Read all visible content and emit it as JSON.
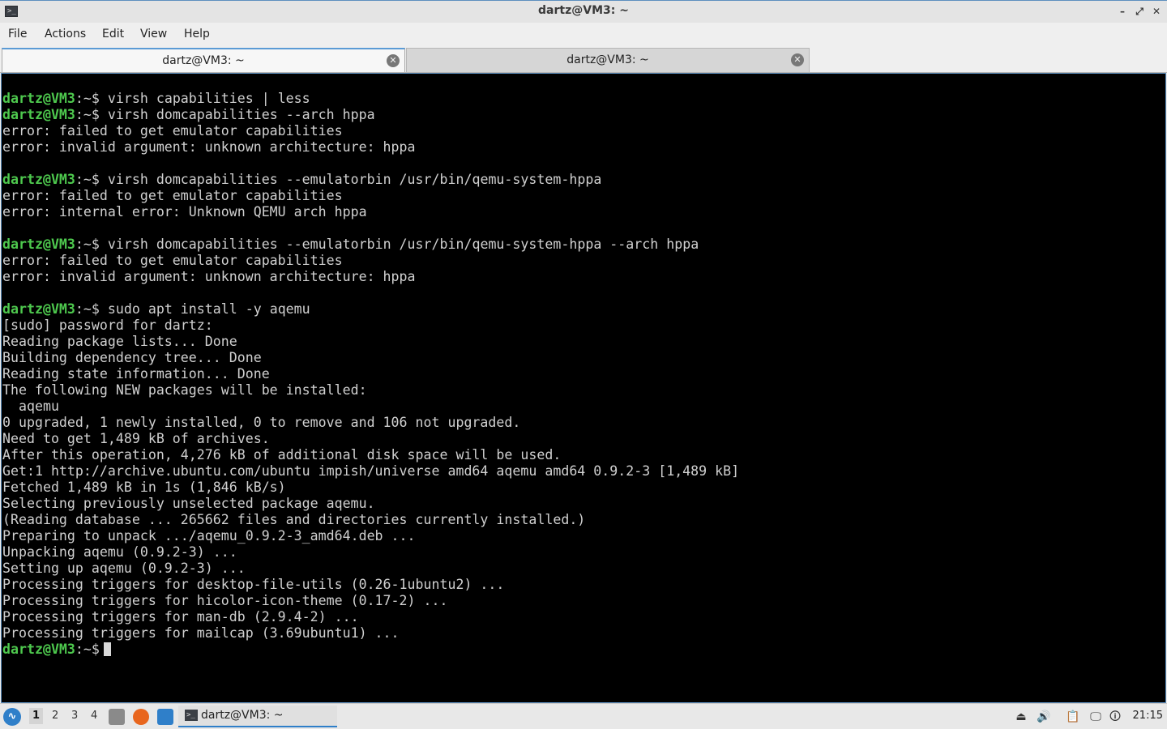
{
  "window": {
    "title": "dartz@VM3: ~",
    "app_icon_glyph": ">_",
    "controls": {
      "minimize": "–",
      "maximize": "⤢",
      "close": "✕"
    }
  },
  "menubar": {
    "items": [
      "File",
      "Actions",
      "Edit",
      "View",
      "Help"
    ]
  },
  "tabs": [
    {
      "label": "dartz@VM3: ~",
      "active": true,
      "close": "✕"
    },
    {
      "label": "dartz@VM3: ~",
      "active": false,
      "close": "✕"
    }
  ],
  "terminal": {
    "prompt_user": "dartz@VM3",
    "prompt_path": ":~$",
    "lines": [
      {
        "prompt": true,
        "text": " virsh capabilities | less"
      },
      {
        "prompt": true,
        "text": " virsh domcapabilities --arch hppa"
      },
      {
        "prompt": false,
        "text": "error: failed to get emulator capabilities"
      },
      {
        "prompt": false,
        "text": "error: invalid argument: unknown architecture: hppa"
      },
      {
        "prompt": false,
        "text": ""
      },
      {
        "prompt": true,
        "text": " virsh domcapabilities --emulatorbin /usr/bin/qemu-system-hppa"
      },
      {
        "prompt": false,
        "text": "error: failed to get emulator capabilities"
      },
      {
        "prompt": false,
        "text": "error: internal error: Unknown QEMU arch hppa"
      },
      {
        "prompt": false,
        "text": ""
      },
      {
        "prompt": true,
        "text": " virsh domcapabilities --emulatorbin /usr/bin/qemu-system-hppa --arch hppa"
      },
      {
        "prompt": false,
        "text": "error: failed to get emulator capabilities"
      },
      {
        "prompt": false,
        "text": "error: invalid argument: unknown architecture: hppa"
      },
      {
        "prompt": false,
        "text": ""
      },
      {
        "prompt": true,
        "text": " sudo apt install -y aqemu"
      },
      {
        "prompt": false,
        "text": "[sudo] password for dartz:"
      },
      {
        "prompt": false,
        "text": "Reading package lists... Done"
      },
      {
        "prompt": false,
        "text": "Building dependency tree... Done"
      },
      {
        "prompt": false,
        "text": "Reading state information... Done"
      },
      {
        "prompt": false,
        "text": "The following NEW packages will be installed:"
      },
      {
        "prompt": false,
        "text": "  aqemu"
      },
      {
        "prompt": false,
        "text": "0 upgraded, 1 newly installed, 0 to remove and 106 not upgraded."
      },
      {
        "prompt": false,
        "text": "Need to get 1,489 kB of archives."
      },
      {
        "prompt": false,
        "text": "After this operation, 4,276 kB of additional disk space will be used."
      },
      {
        "prompt": false,
        "text": "Get:1 http://archive.ubuntu.com/ubuntu impish/universe amd64 aqemu amd64 0.9.2-3 [1,489 kB]"
      },
      {
        "prompt": false,
        "text": "Fetched 1,489 kB in 1s (1,846 kB/s)"
      },
      {
        "prompt": false,
        "text": "Selecting previously unselected package aqemu."
      },
      {
        "prompt": false,
        "text": "(Reading database ... 265662 files and directories currently installed.)"
      },
      {
        "prompt": false,
        "text": "Preparing to unpack .../aqemu_0.9.2-3_amd64.deb ..."
      },
      {
        "prompt": false,
        "text": "Unpacking aqemu (0.9.2-3) ..."
      },
      {
        "prompt": false,
        "text": "Setting up aqemu (0.9.2-3) ..."
      },
      {
        "prompt": false,
        "text": "Processing triggers for desktop-file-utils (0.26-1ubuntu2) ..."
      },
      {
        "prompt": false,
        "text": "Processing triggers for hicolor-icon-theme (0.17-2) ..."
      },
      {
        "prompt": false,
        "text": "Processing triggers for man-db (2.9.4-2) ..."
      },
      {
        "prompt": false,
        "text": "Processing triggers for mailcap (3.69ubuntu1) ..."
      },
      {
        "prompt": true,
        "text": "",
        "cursor": true
      }
    ]
  },
  "taskbar": {
    "start_icon": "lubuntu-start-icon",
    "desktops": [
      "1",
      "2",
      "3",
      "4"
    ],
    "active_desktop": "1",
    "launchers": [
      {
        "name": "file-manager-icon",
        "color": "#8a8a8a"
      },
      {
        "name": "firefox-icon",
        "color": "#e8661e"
      },
      {
        "name": "show-desktop-icon",
        "color": "#2f7fc9"
      }
    ],
    "task": {
      "label": "dartz@VM3: ~",
      "icon": ">_"
    },
    "tray": [
      {
        "name": "eject-icon",
        "glyph": "⏏"
      },
      {
        "name": "volume-icon",
        "glyph": "🔊"
      },
      {
        "name": "clipboard-icon",
        "glyph": "📋"
      },
      {
        "name": "network-icon",
        "glyph": "🖵"
      },
      {
        "name": "update-notifier-icon",
        "glyph": "🛈"
      }
    ],
    "clock": "21:15"
  },
  "colors": {
    "prompt": "#4ec94e",
    "terminal_bg": "#000000",
    "terminal_fg": "#d0d0d0",
    "accent": "#5b9bd5"
  }
}
